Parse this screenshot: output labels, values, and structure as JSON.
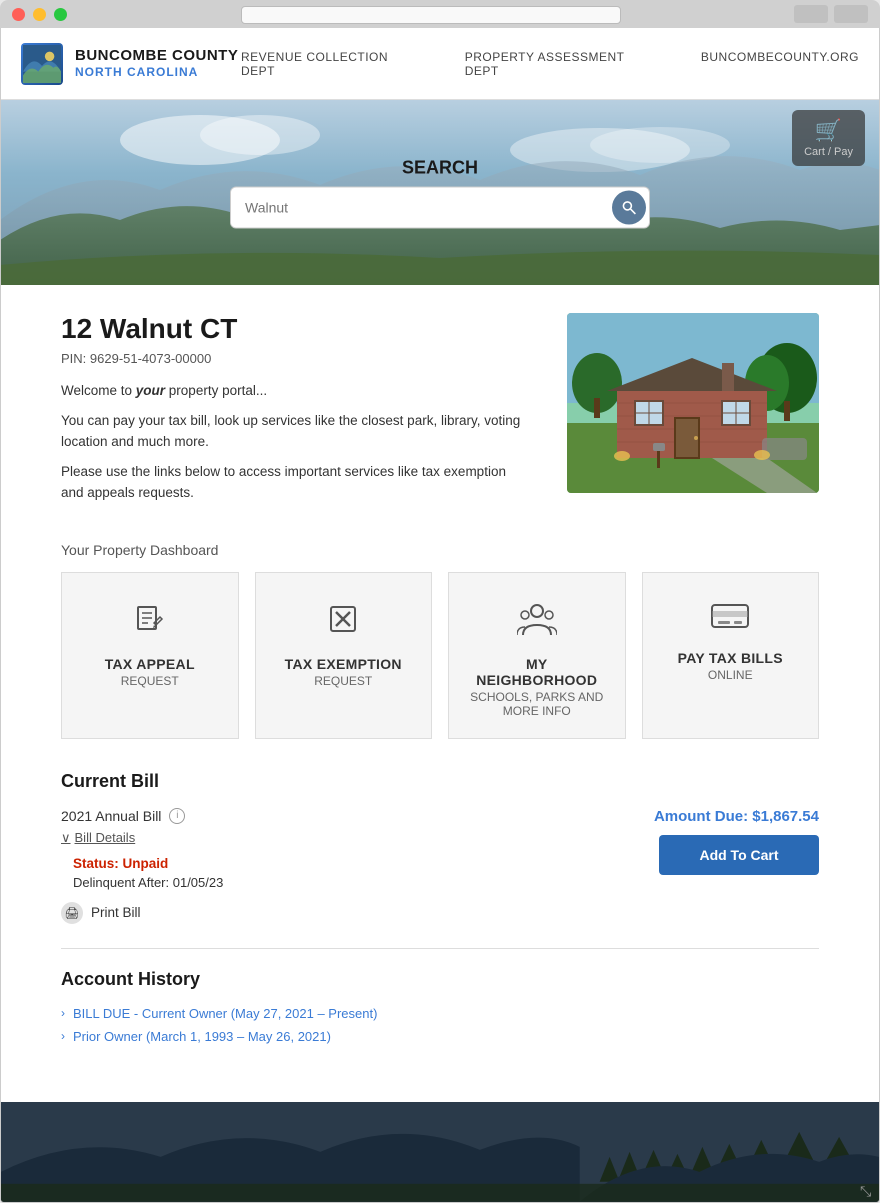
{
  "window": {
    "address_bar": ""
  },
  "header": {
    "logo_title": "BUNCOMBE COUNTY",
    "logo_subtitle": "NORTH CAROLINA",
    "nav_items": [
      {
        "label": "REVENUE COLLECTION DEPT"
      },
      {
        "label": "PROPERTY ASSESSMENT DEPT"
      },
      {
        "label": "BUNCOMBECOUNTY.ORG"
      }
    ],
    "cart_label": "Cart / Pay"
  },
  "search": {
    "label": "SEARCH",
    "placeholder": "Walnut"
  },
  "property": {
    "title": "12 Walnut CT",
    "pin_label": "PIN: 9629-51-4073-00000",
    "desc1_prefix": "Welcome to ",
    "desc1_bold": "your",
    "desc1_suffix": " property portal...",
    "desc2": "You can pay your tax bill, look up services like the closest park, library, voting location and much more.",
    "desc3": "Please use the links below to access important services like tax exemption and appeals requests."
  },
  "dashboard": {
    "label": "Your Property Dashboard",
    "cards": [
      {
        "id": "tax-appeal",
        "title": "TAX APPEAL",
        "subtitle": "REQUEST"
      },
      {
        "id": "tax-exemption",
        "title": "TAX EXEMPTION",
        "subtitle": "REQUEST"
      },
      {
        "id": "my-neighborhood",
        "title": "MY NEIGHBORHOOD",
        "subtitle": "SCHOOLS, PARKS AND MORE INFO"
      },
      {
        "id": "pay-tax-bills",
        "title": "PAY TAX BILLS",
        "subtitle": "ONLINE"
      }
    ]
  },
  "bill": {
    "section_title": "Current Bill",
    "bill_year_label": "2021 Annual Bill",
    "details_toggle": "Bill Details",
    "status_label": "Status: Unpaid",
    "delinquent_label": "Delinquent After: 01/05/23",
    "amount_due_label": "Amount Due: $1,867.54",
    "add_to_cart_label": "Add To Cart",
    "print_bill_label": "Print Bill"
  },
  "account_history": {
    "section_title": "Account History",
    "items": [
      {
        "label": "BILL DUE - Current Owner (May 27, 2021 – Present)"
      },
      {
        "label": "Prior Owner (March 1, 1993 – May 26, 2021)"
      }
    ]
  },
  "icons": {
    "tax_appeal": "✎",
    "tax_exemption": "✖",
    "neighborhood": "👥",
    "pay_bills": "💳",
    "cart": "🛒",
    "print": "🖨",
    "info": "i",
    "chevron_down": "∨",
    "chevron_right": "›",
    "search": "🔍"
  }
}
